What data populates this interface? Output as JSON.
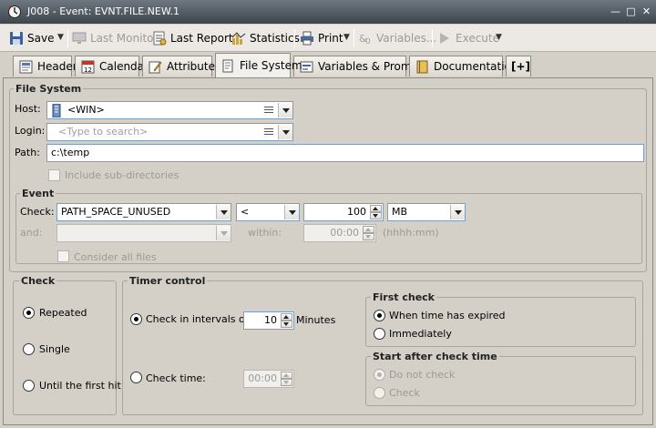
{
  "window": {
    "title": "J008 - Event: EVNT.FILE.NEW.1"
  },
  "toolbar": {
    "save": "Save",
    "last_monitor": "Last Monitor",
    "last_report": "Last Report",
    "statistics": "Statistics",
    "print": "Print",
    "variables": "Variables...",
    "execute": "Execute"
  },
  "tabs": [
    {
      "label": "Header"
    },
    {
      "label": "Calendar"
    },
    {
      "label": "Attributes"
    },
    {
      "label": "File System"
    },
    {
      "label": "Variables & Prompts"
    },
    {
      "label": "Documentation"
    },
    {
      "label": "[+]"
    }
  ],
  "file_system": {
    "group_label": "File System",
    "host_label": "Host:",
    "host_value": "<WIN>",
    "login_label": "Login:",
    "login_placeholder": "<Type to search>",
    "path_label": "Path:",
    "path_value": "c:\\temp",
    "include_subdirs": "Include sub-directories"
  },
  "event": {
    "group_label": "Event",
    "check_label": "Check:",
    "check_value": "PATH_SPACE_UNUSED",
    "operator": "<",
    "amount": "100",
    "unit": "MB",
    "and_label": "and:",
    "within_label": "within:",
    "within_value": "00:00",
    "within_hint": "(hhhh:mm)",
    "consider_all": "Consider all files"
  },
  "check": {
    "group_label": "Check",
    "options": [
      "Repeated",
      "Single",
      "Until the first hit"
    ],
    "selected": "Repeated"
  },
  "timer": {
    "group_label": "Timer control",
    "interval_label": "Check in intervals of:",
    "interval_value": "10",
    "interval_unit": "Minutes",
    "check_time_label": "Check time:",
    "check_time_value": "00:00"
  },
  "first_check": {
    "group_label": "First check",
    "options": [
      "When time has expired",
      "Immediately"
    ],
    "selected": "When time has expired"
  },
  "start_after": {
    "group_label": "Start after check time",
    "options": [
      "Do not check",
      "Check"
    ],
    "selected": "Do not check"
  }
}
